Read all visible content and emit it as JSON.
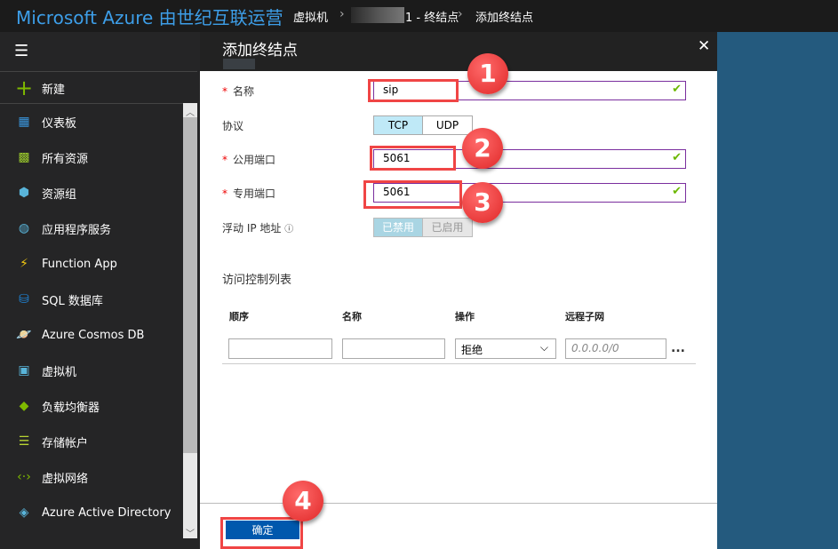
{
  "topbar": {
    "brand": "Microsoft Azure 由世纪互联运营",
    "breadcrumb": [
      "虚拟机",
      "1 - 终结点",
      "添加终结点"
    ]
  },
  "sidebar": {
    "new_label": "新建",
    "items": [
      {
        "label": "仪表板",
        "icon": "dashboard-icon",
        "color": "#3a96dd"
      },
      {
        "label": "所有资源",
        "icon": "grid-icon",
        "color": "#9ac92c"
      },
      {
        "label": "资源组",
        "icon": "cube-icon",
        "color": "#59b4d9"
      },
      {
        "label": "应用程序服务",
        "icon": "globe-icon",
        "color": "#59b4d9"
      },
      {
        "label": "Function App",
        "icon": "bolt-icon",
        "color": "#f2c811"
      },
      {
        "label": "SQL 数据库",
        "icon": "database-icon",
        "color": "#1f85d8"
      },
      {
        "label": "Azure Cosmos DB",
        "icon": "planet-icon",
        "color": "#59b4d9"
      },
      {
        "label": "虚拟机",
        "icon": "monitor-icon",
        "color": "#59b4d9"
      },
      {
        "label": "负载均衡器",
        "icon": "diamond-icon",
        "color": "#7fba00"
      },
      {
        "label": "存储帐户",
        "icon": "storage-icon",
        "color": "#b8d432"
      },
      {
        "label": "虚拟网络",
        "icon": "network-icon",
        "color": "#7fba00"
      },
      {
        "label": "Azure Active Directory",
        "icon": "aad-icon",
        "color": "#59b4d9"
      }
    ]
  },
  "panel": {
    "title": "添加终结点",
    "close": "✕",
    "name_label": "名称",
    "name_value": "sip",
    "protocol_label": "协议",
    "protocol_options": [
      "TCP",
      "UDP"
    ],
    "protocol_selected": "TCP",
    "public_port_label": "公用端口",
    "public_port_value": "5061",
    "private_port_label": "专用端口",
    "private_port_value": "5061",
    "floating_ip_label": "浮动 IP 地址",
    "floating_ip_options": [
      "已禁用",
      "已启用"
    ],
    "floating_ip_selected": "已禁用",
    "acl_title": "访问控制列表",
    "acl_headers": [
      "顺序",
      "名称",
      "操作",
      "远程子网"
    ],
    "acl_action_value": "拒绝",
    "acl_subnet_placeholder": "0.0.0.0/0",
    "more": "...",
    "ok_label": "确定"
  },
  "annotations": [
    "1",
    "2",
    "3",
    "4"
  ],
  "colors": {
    "accent": "#3d9ee8",
    "button": "#0058ad",
    "invalid_border": "#7a2e9e",
    "check": "#6bb700",
    "annotation": "#f04545"
  }
}
